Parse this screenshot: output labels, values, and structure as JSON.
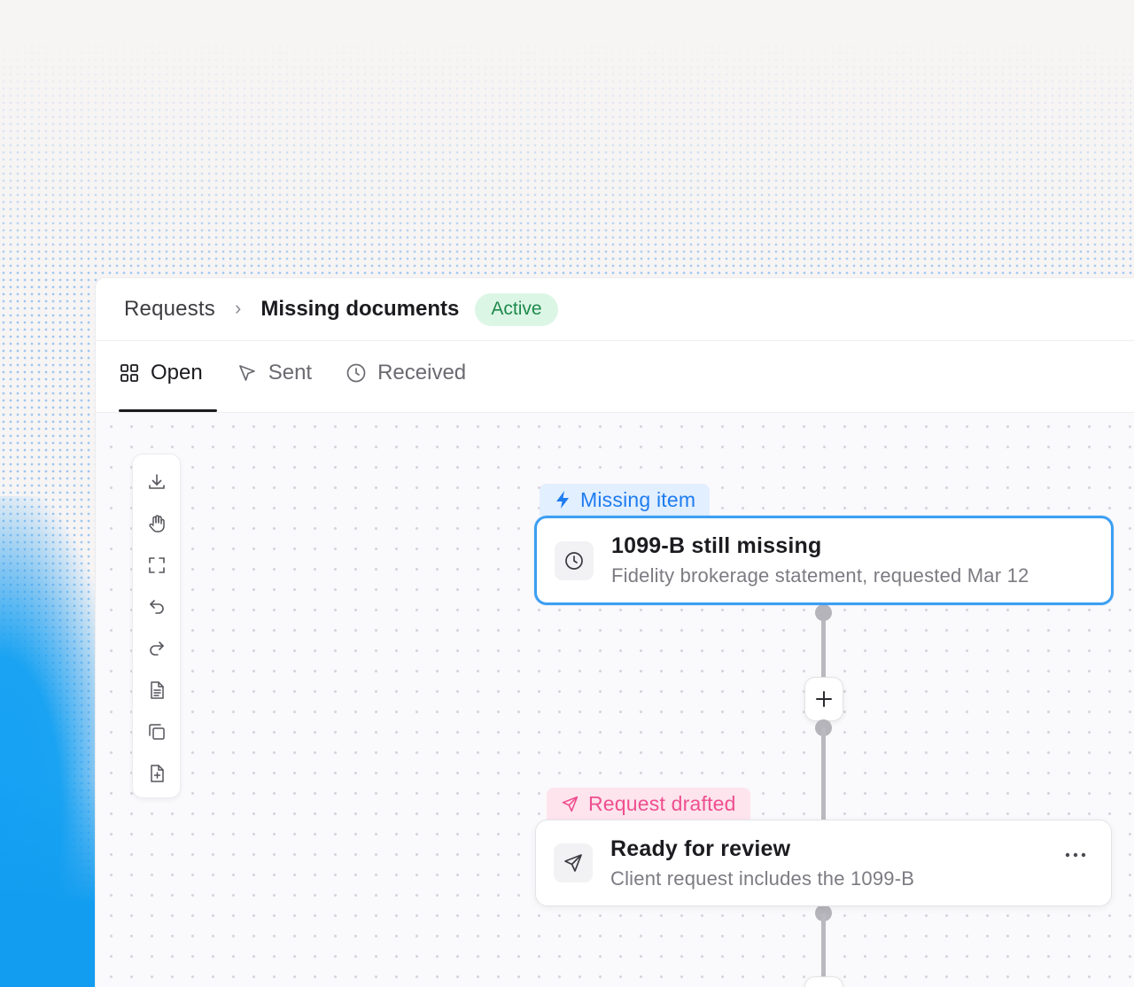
{
  "breadcrumb": {
    "root": "Requests",
    "separator": "›",
    "current": "Missing documents",
    "status": "Active"
  },
  "tabs": [
    {
      "label": "Open",
      "icon": "grid-icon",
      "active": true
    },
    {
      "label": "Sent",
      "icon": "cursor-arrow-icon",
      "active": false
    },
    {
      "label": "Received",
      "icon": "clock-icon",
      "active": false
    }
  ],
  "toolbar": {
    "tools": [
      "download-icon",
      "hand-icon",
      "fit-screen-icon",
      "undo-icon",
      "redo-icon",
      "document-icon",
      "copy-icon",
      "add-file-icon"
    ]
  },
  "flow": {
    "trigger": {
      "tag": "Missing item",
      "title": "1099-B still missing",
      "subtitle": "Fidelity brokerage statement, requested Mar 12",
      "icon": "clock-icon"
    },
    "action": {
      "tag": "Request drafted",
      "title": "Ready for review",
      "subtitle": "Client request includes the 1099-B",
      "icon": "send-icon"
    },
    "add_step_icon": "plus-icon"
  },
  "colors": {
    "accent_blue": "#3c9ff2",
    "tag_blue_text": "#1e7cf0",
    "tag_pink_text": "#ef4f8f",
    "status_green": "#1f8a4c",
    "status_green_bg": "#dcf6e6"
  }
}
